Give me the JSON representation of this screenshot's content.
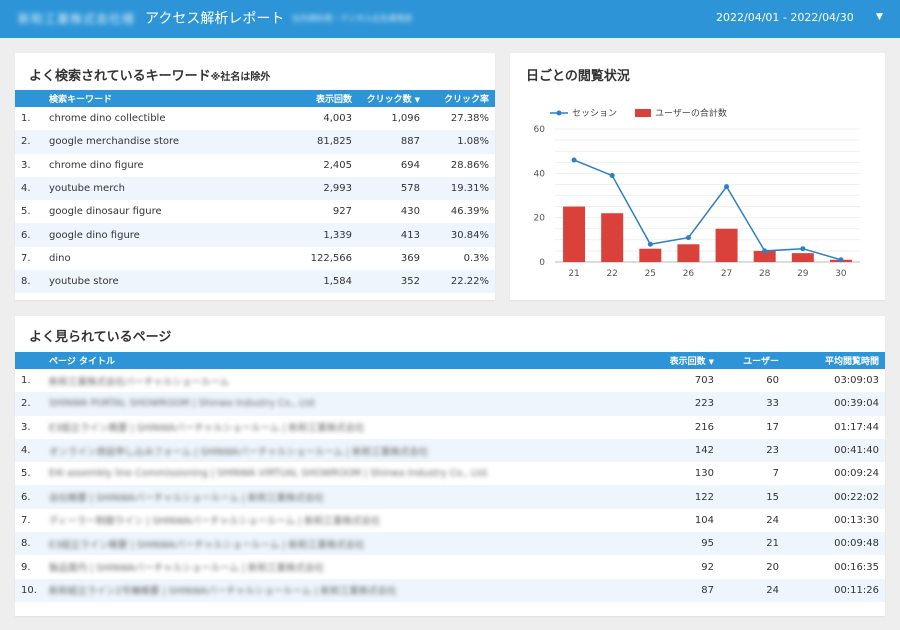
{
  "header": {
    "company": "新和工業株式会社様",
    "title": "アクセス解析レポート",
    "subtitle": "社内資料用・デジタル広告運用部",
    "date_range": "2022/04/01 - 2022/04/30",
    "dropdown_icon": "triangle-down-icon"
  },
  "keywords": {
    "title": "よく検索されているキーワード",
    "title_note": "※社名は除外",
    "columns": [
      "",
      "検索キーワード",
      "表示回数",
      "クリック数",
      "クリック率"
    ],
    "sort_icon": "▼",
    "rows": [
      {
        "rank": "1.",
        "keyword": "chrome dino collectible",
        "impressions": "4,003",
        "clicks": "1,096",
        "ctr": "27.38%"
      },
      {
        "rank": "2.",
        "keyword": "google merchandise store",
        "impressions": "81,825",
        "clicks": "887",
        "ctr": "1.08%"
      },
      {
        "rank": "3.",
        "keyword": "chrome dino figure",
        "impressions": "2,405",
        "clicks": "694",
        "ctr": "28.86%"
      },
      {
        "rank": "4.",
        "keyword": "youtube merch",
        "impressions": "2,993",
        "clicks": "578",
        "ctr": "19.31%"
      },
      {
        "rank": "5.",
        "keyword": "google dinosaur figure",
        "impressions": "927",
        "clicks": "430",
        "ctr": "46.39%"
      },
      {
        "rank": "6.",
        "keyword": "google dino figure",
        "impressions": "1,339",
        "clicks": "413",
        "ctr": "30.84%"
      },
      {
        "rank": "7.",
        "keyword": "dino",
        "impressions": "122,566",
        "clicks": "369",
        "ctr": "0.3%"
      },
      {
        "rank": "8.",
        "keyword": "youtube store",
        "impressions": "1,584",
        "clicks": "352",
        "ctr": "22.22%"
      }
    ]
  },
  "daily": {
    "title": "日ごとの閲覧状況",
    "colors": {
      "line": "#2d7fc6",
      "bar": "#d9413a",
      "grid": "#e6e6e6"
    }
  },
  "chart_data": {
    "type": "bar",
    "categories": [
      "21",
      "22",
      "25",
      "26",
      "27",
      "28",
      "29",
      "30"
    ],
    "series": [
      {
        "name": "セッション",
        "type": "line",
        "values": [
          46,
          39,
          8,
          11,
          34,
          5,
          6,
          1
        ]
      },
      {
        "name": "ユーザーの合計数",
        "type": "bar",
        "values": [
          25,
          22,
          6,
          8,
          15,
          5,
          4,
          1
        ]
      }
    ],
    "yticks": [
      "0",
      "20",
      "40",
      "60"
    ],
    "ylim": [
      0,
      60
    ],
    "legend_position": "top-left",
    "grid": true
  },
  "pages": {
    "title": "よく見られているページ",
    "columns": [
      "",
      "ページ タイトル",
      "表示回数",
      "ユーザー",
      "平均閲覧時間"
    ],
    "sort_icon": "▼",
    "rows": [
      {
        "rank": "1.",
        "page": "新和工業株式会社バーチャルショールーム",
        "views": "703",
        "users": "60",
        "avg_time": "03:09:03"
      },
      {
        "rank": "2.",
        "page": "SHINWA PORTAL SHOWROOM | Shinwa Industry Co., Ltd",
        "views": "223",
        "users": "33",
        "avg_time": "00:39:04"
      },
      {
        "rank": "3.",
        "page": "E3組立ライン概要 | SHINWAバーチャルショールーム | 新和工業株式会社",
        "views": "216",
        "users": "17",
        "avg_time": "01:17:44"
      },
      {
        "rank": "4.",
        "page": "オンライン商談申し込みフォーム | SHINWAバーチャルショールーム | 新和工業株式会社",
        "views": "142",
        "users": "23",
        "avg_time": "00:41:40"
      },
      {
        "rank": "5.",
        "page": "E4I assembly line Commissioning | SHINWA VIRTUAL SHOWROOM | Shinwa Industry Co., Ltd.",
        "views": "130",
        "users": "7",
        "avg_time": "00:09:24"
      },
      {
        "rank": "6.",
        "page": "会社概要 | SHINWAバーチャルショールーム | 新和工業株式会社",
        "views": "122",
        "users": "15",
        "avg_time": "00:22:02"
      },
      {
        "rank": "7.",
        "page": "ディーラー制御ライン | SHINWAバーチャルショールーム | 新和工業株式会社",
        "views": "104",
        "users": "24",
        "avg_time": "00:13:30"
      },
      {
        "rank": "8.",
        "page": "E3組立ライン概要 | SHINWAバーチャルショールーム | 新和工業株式会社",
        "views": "95",
        "users": "21",
        "avg_time": "00:09:48"
      },
      {
        "rank": "9.",
        "page": "製品案内 | SHINWAバーチャルショールーム | 新和工業株式会社",
        "views": "92",
        "users": "20",
        "avg_time": "00:16:35"
      },
      {
        "rank": "10.",
        "page": "新和組立ライン2号機概要 | SHINWAバーチャルショールーム | 新和工業株式会社",
        "views": "87",
        "users": "24",
        "avg_time": "00:11:26"
      }
    ]
  }
}
